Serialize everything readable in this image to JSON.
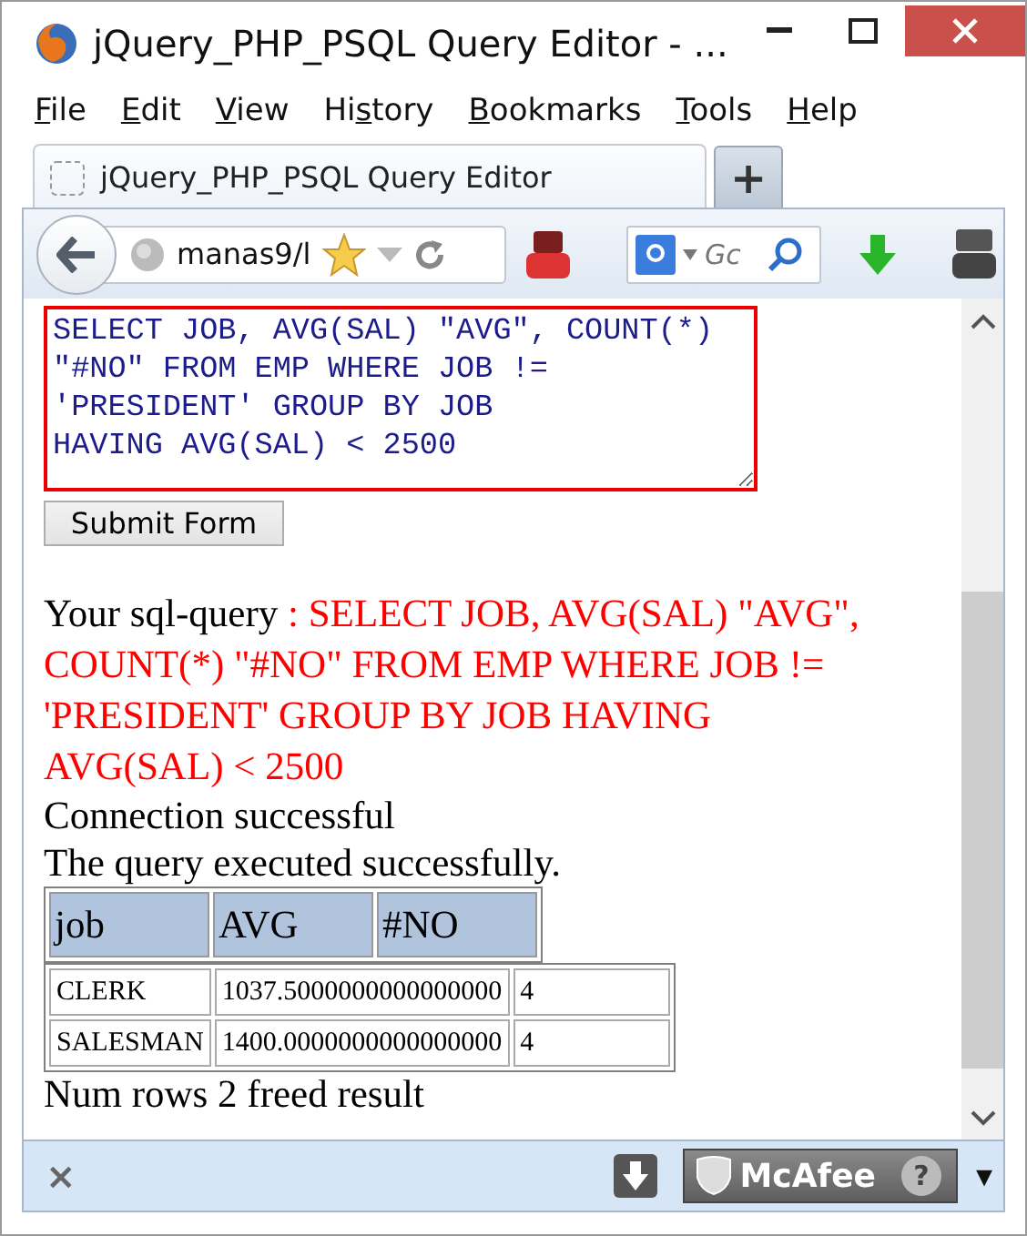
{
  "window": {
    "title": "jQuery_PHP_PSQL Query Editor - ..."
  },
  "menu": [
    {
      "key": "F",
      "after": "ile"
    },
    {
      "key": "E",
      "after": "dit"
    },
    {
      "key": "V",
      "after": "iew"
    },
    {
      "before": "Hi",
      "key": "s",
      "after": "tory"
    },
    {
      "key": "B",
      "after": "ookmarks"
    },
    {
      "key": "T",
      "after": "ools"
    },
    {
      "key": "H",
      "after": "elp"
    }
  ],
  "tabs": [
    {
      "label": "jQuery_PHP_PSQL Query Editor",
      "selected": true
    }
  ],
  "new_tab": "+",
  "navbar": {
    "url": "manas9/l",
    "search": {
      "placeholder": "Gc"
    }
  },
  "page": {
    "query_field": {
      "value": "SELECT JOB, AVG(SAL) \"AVG\", COUNT(*) \"#NO\" FROM EMP WHERE JOB != 'PRESIDENT' GROUP BY JOB\nHAVING AVG(SAL) < 2500"
    },
    "submit": "Submit Form",
    "query_label": "Your sql-query",
    "query_text": ": SELECT JOB, AVG(SAL) \"AVG\", COUNT(*) \"#NO\" FROM EMP WHERE JOB != 'PRESIDENT' GROUP BY JOB HAVING AVG(SAL) < 2500",
    "messages": [
      "Connection successful",
      "The query executed successfully."
    ],
    "result": {
      "columns": [
        "job",
        "AVG",
        "#NO"
      ],
      "rows": [
        [
          "CLERK",
          "1037.5000000000000000",
          "4"
        ],
        [
          "SALESMAN",
          "1400.0000000000000000",
          "4"
        ]
      ]
    },
    "footer": "Num rows 2 freed result"
  },
  "addon_bar": {
    "close": "×",
    "badge": "McAfee",
    "help": "?",
    "menu": "▾"
  }
}
